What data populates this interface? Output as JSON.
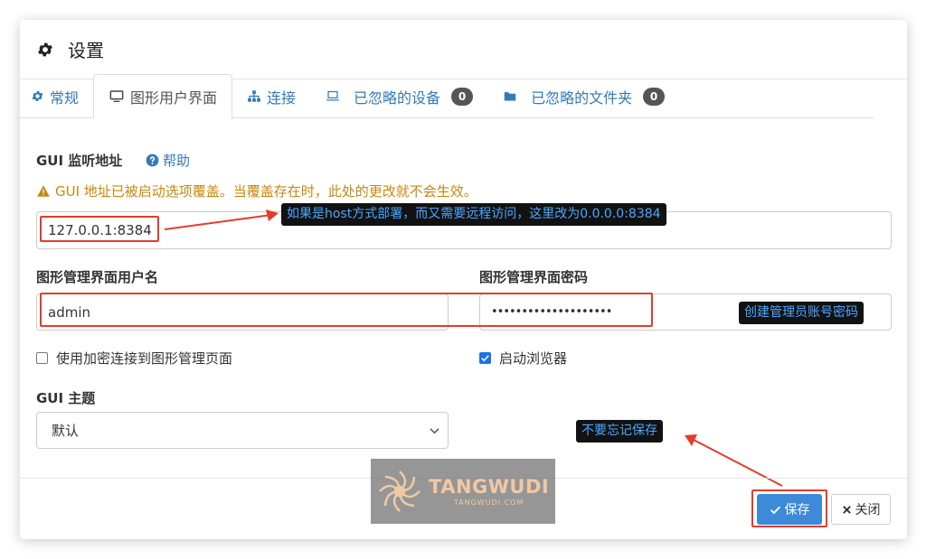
{
  "dialog": {
    "title": "设置"
  },
  "tabs": [
    {
      "label": "常规",
      "icon": "gear-icon"
    },
    {
      "label": "图形用户界面",
      "icon": "monitor-icon"
    },
    {
      "label": "连接",
      "icon": "sitemap-icon"
    },
    {
      "label": "已忽略的设备",
      "icon": "laptop-icon",
      "badge": "0"
    },
    {
      "label": "已忽略的文件夹",
      "icon": "folder-icon",
      "badge": "0"
    }
  ],
  "gui_address": {
    "label": "GUI 监听地址",
    "help": "帮助",
    "warning": "GUI 地址已被启动选项覆盖。当覆盖存在时，此处的更改就不会生效。",
    "value": "127.0.0.1:8384"
  },
  "username": {
    "label": "图形管理界面用户名",
    "value": "admin"
  },
  "password": {
    "label": "图形管理界面密码",
    "value": "••••••••••••••••••••"
  },
  "options": {
    "tls": {
      "label": "使用加密连接到图形管理页面",
      "checked": false
    },
    "browser": {
      "label": "启动浏览器",
      "checked": true
    }
  },
  "theme": {
    "label": "GUI 主题",
    "value": "默认"
  },
  "annotations": {
    "address_note": "如果是host方式部署，而又需要远程访问，这里改为0.0.0.0:8384",
    "credentials_note": "创建管理员账号密码",
    "save_note": "不要忘记保存"
  },
  "footer": {
    "save": "保存",
    "close": "关闭"
  },
  "watermark": {
    "brand": "TANGWUDI",
    "sub": "TANGWUDI.COM"
  },
  "colors": {
    "link": "#337ab7",
    "primary": "#3c8ad8",
    "warning": "#c8870f",
    "annotation_red": "#e53b2c"
  }
}
